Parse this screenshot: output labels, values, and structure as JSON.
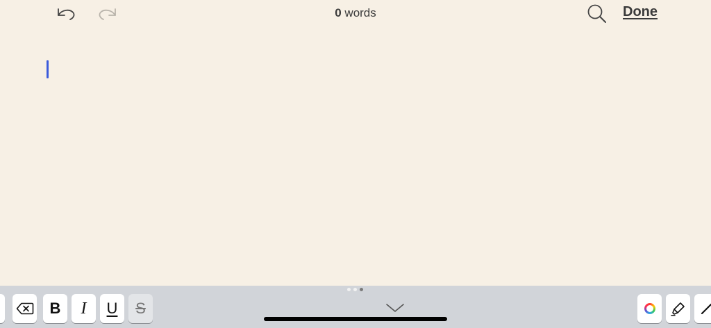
{
  "topbar": {
    "undo_icon": "undo-icon",
    "redo_icon": "redo-icon",
    "word_count_number": "0",
    "word_count_label": " words",
    "search_icon": "search-icon",
    "done_label": "Done"
  },
  "editor": {
    "text": "",
    "caret_color": "#3b5bdb",
    "background": "#f7f0e5"
  },
  "toolbar": {
    "page_count": 3,
    "active_page": 3,
    "bold_label": "B",
    "italic_label": "I",
    "underline_label": "U",
    "strike_label": "S",
    "delete_icon": "backspace-icon",
    "collapse_icon": "chevron-down-icon",
    "color_icon": "color-wheel-icon",
    "highlighter_icon": "highlighter-icon",
    "pen_icon": "pen-icon",
    "selected_style": "strikethrough"
  }
}
